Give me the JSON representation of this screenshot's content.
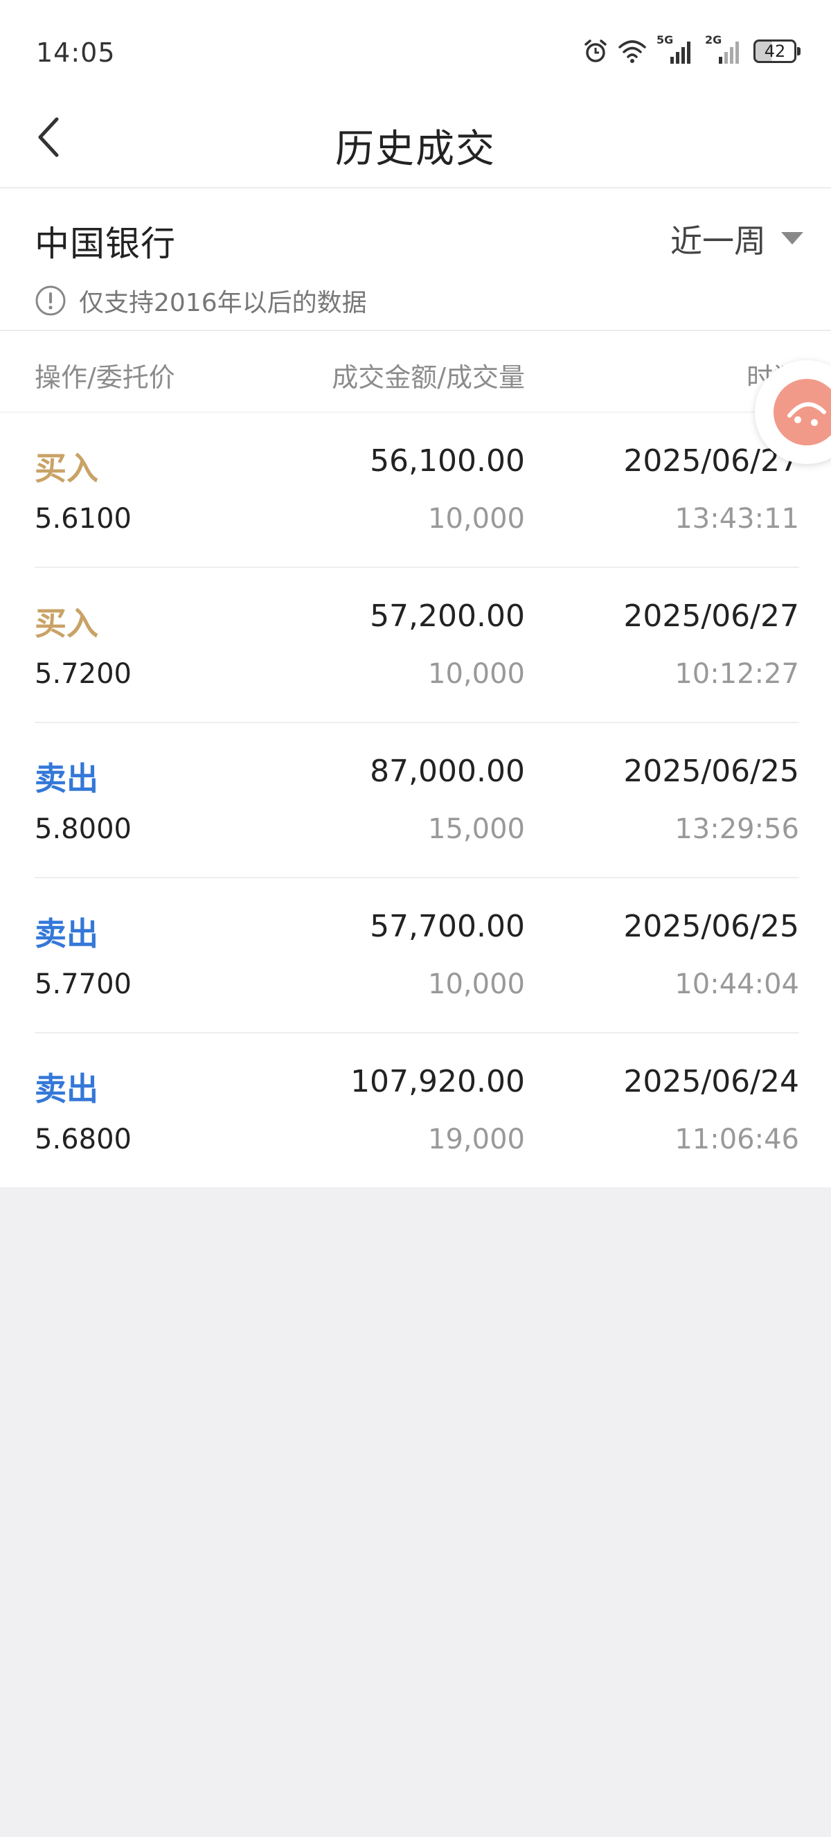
{
  "status_bar": {
    "time": "14:05",
    "battery": "42",
    "network_1": "5G",
    "network_2": "2G"
  },
  "header": {
    "title": "历史成交"
  },
  "filter": {
    "stock_name": "中国银行",
    "period": "近一周",
    "notice": "仅支持2016年以后的数据"
  },
  "table": {
    "columns": [
      "操作/委托价",
      "成交金额/成交量",
      "时间"
    ],
    "rows": [
      {
        "action": "买入",
        "side": "buy",
        "price": "5.6100",
        "amount": "56,100.00",
        "quantity": "10,000",
        "date": "2025/06/27",
        "time": "13:43:11"
      },
      {
        "action": "买入",
        "side": "buy",
        "price": "5.7200",
        "amount": "57,200.00",
        "quantity": "10,000",
        "date": "2025/06/27",
        "time": "10:12:27"
      },
      {
        "action": "卖出",
        "side": "sell",
        "price": "5.8000",
        "amount": "87,000.00",
        "quantity": "15,000",
        "date": "2025/06/25",
        "time": "13:29:56"
      },
      {
        "action": "卖出",
        "side": "sell",
        "price": "5.7700",
        "amount": "57,700.00",
        "quantity": "10,000",
        "date": "2025/06/25",
        "time": "10:44:04"
      },
      {
        "action": "卖出",
        "side": "sell",
        "price": "5.6800",
        "amount": "107,920.00",
        "quantity": "19,000",
        "date": "2025/06/24",
        "time": "11:06:46"
      }
    ]
  },
  "colors": {
    "buy": "#c9a266",
    "sell": "#3478d8",
    "muted": "#999999",
    "background": "#f0f0f2"
  }
}
